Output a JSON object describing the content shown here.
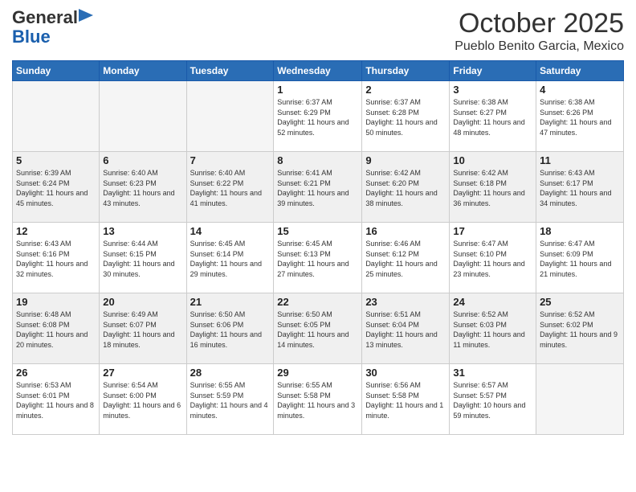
{
  "header": {
    "logo_line1": "General",
    "logo_line2": "Blue",
    "month_title": "October 2025",
    "subtitle": "Pueblo Benito Garcia, Mexico"
  },
  "days_of_week": [
    "Sunday",
    "Monday",
    "Tuesday",
    "Wednesday",
    "Thursday",
    "Friday",
    "Saturday"
  ],
  "weeks": [
    [
      {
        "day": "",
        "info": ""
      },
      {
        "day": "",
        "info": ""
      },
      {
        "day": "",
        "info": ""
      },
      {
        "day": "1",
        "info": "Sunrise: 6:37 AM\nSunset: 6:29 PM\nDaylight: 11 hours and 52 minutes."
      },
      {
        "day": "2",
        "info": "Sunrise: 6:37 AM\nSunset: 6:28 PM\nDaylight: 11 hours and 50 minutes."
      },
      {
        "day": "3",
        "info": "Sunrise: 6:38 AM\nSunset: 6:27 PM\nDaylight: 11 hours and 48 minutes."
      },
      {
        "day": "4",
        "info": "Sunrise: 6:38 AM\nSunset: 6:26 PM\nDaylight: 11 hours and 47 minutes."
      }
    ],
    [
      {
        "day": "5",
        "info": "Sunrise: 6:39 AM\nSunset: 6:24 PM\nDaylight: 11 hours and 45 minutes."
      },
      {
        "day": "6",
        "info": "Sunrise: 6:40 AM\nSunset: 6:23 PM\nDaylight: 11 hours and 43 minutes."
      },
      {
        "day": "7",
        "info": "Sunrise: 6:40 AM\nSunset: 6:22 PM\nDaylight: 11 hours and 41 minutes."
      },
      {
        "day": "8",
        "info": "Sunrise: 6:41 AM\nSunset: 6:21 PM\nDaylight: 11 hours and 39 minutes."
      },
      {
        "day": "9",
        "info": "Sunrise: 6:42 AM\nSunset: 6:20 PM\nDaylight: 11 hours and 38 minutes."
      },
      {
        "day": "10",
        "info": "Sunrise: 6:42 AM\nSunset: 6:18 PM\nDaylight: 11 hours and 36 minutes."
      },
      {
        "day": "11",
        "info": "Sunrise: 6:43 AM\nSunset: 6:17 PM\nDaylight: 11 hours and 34 minutes."
      }
    ],
    [
      {
        "day": "12",
        "info": "Sunrise: 6:43 AM\nSunset: 6:16 PM\nDaylight: 11 hours and 32 minutes."
      },
      {
        "day": "13",
        "info": "Sunrise: 6:44 AM\nSunset: 6:15 PM\nDaylight: 11 hours and 30 minutes."
      },
      {
        "day": "14",
        "info": "Sunrise: 6:45 AM\nSunset: 6:14 PM\nDaylight: 11 hours and 29 minutes."
      },
      {
        "day": "15",
        "info": "Sunrise: 6:45 AM\nSunset: 6:13 PM\nDaylight: 11 hours and 27 minutes."
      },
      {
        "day": "16",
        "info": "Sunrise: 6:46 AM\nSunset: 6:12 PM\nDaylight: 11 hours and 25 minutes."
      },
      {
        "day": "17",
        "info": "Sunrise: 6:47 AM\nSunset: 6:10 PM\nDaylight: 11 hours and 23 minutes."
      },
      {
        "day": "18",
        "info": "Sunrise: 6:47 AM\nSunset: 6:09 PM\nDaylight: 11 hours and 21 minutes."
      }
    ],
    [
      {
        "day": "19",
        "info": "Sunrise: 6:48 AM\nSunset: 6:08 PM\nDaylight: 11 hours and 20 minutes."
      },
      {
        "day": "20",
        "info": "Sunrise: 6:49 AM\nSunset: 6:07 PM\nDaylight: 11 hours and 18 minutes."
      },
      {
        "day": "21",
        "info": "Sunrise: 6:50 AM\nSunset: 6:06 PM\nDaylight: 11 hours and 16 minutes."
      },
      {
        "day": "22",
        "info": "Sunrise: 6:50 AM\nSunset: 6:05 PM\nDaylight: 11 hours and 14 minutes."
      },
      {
        "day": "23",
        "info": "Sunrise: 6:51 AM\nSunset: 6:04 PM\nDaylight: 11 hours and 13 minutes."
      },
      {
        "day": "24",
        "info": "Sunrise: 6:52 AM\nSunset: 6:03 PM\nDaylight: 11 hours and 11 minutes."
      },
      {
        "day": "25",
        "info": "Sunrise: 6:52 AM\nSunset: 6:02 PM\nDaylight: 11 hours and 9 minutes."
      }
    ],
    [
      {
        "day": "26",
        "info": "Sunrise: 6:53 AM\nSunset: 6:01 PM\nDaylight: 11 hours and 8 minutes."
      },
      {
        "day": "27",
        "info": "Sunrise: 6:54 AM\nSunset: 6:00 PM\nDaylight: 11 hours and 6 minutes."
      },
      {
        "day": "28",
        "info": "Sunrise: 6:55 AM\nSunset: 5:59 PM\nDaylight: 11 hours and 4 minutes."
      },
      {
        "day": "29",
        "info": "Sunrise: 6:55 AM\nSunset: 5:58 PM\nDaylight: 11 hours and 3 minutes."
      },
      {
        "day": "30",
        "info": "Sunrise: 6:56 AM\nSunset: 5:58 PM\nDaylight: 11 hours and 1 minute."
      },
      {
        "day": "31",
        "info": "Sunrise: 6:57 AM\nSunset: 5:57 PM\nDaylight: 10 hours and 59 minutes."
      },
      {
        "day": "",
        "info": ""
      }
    ]
  ]
}
